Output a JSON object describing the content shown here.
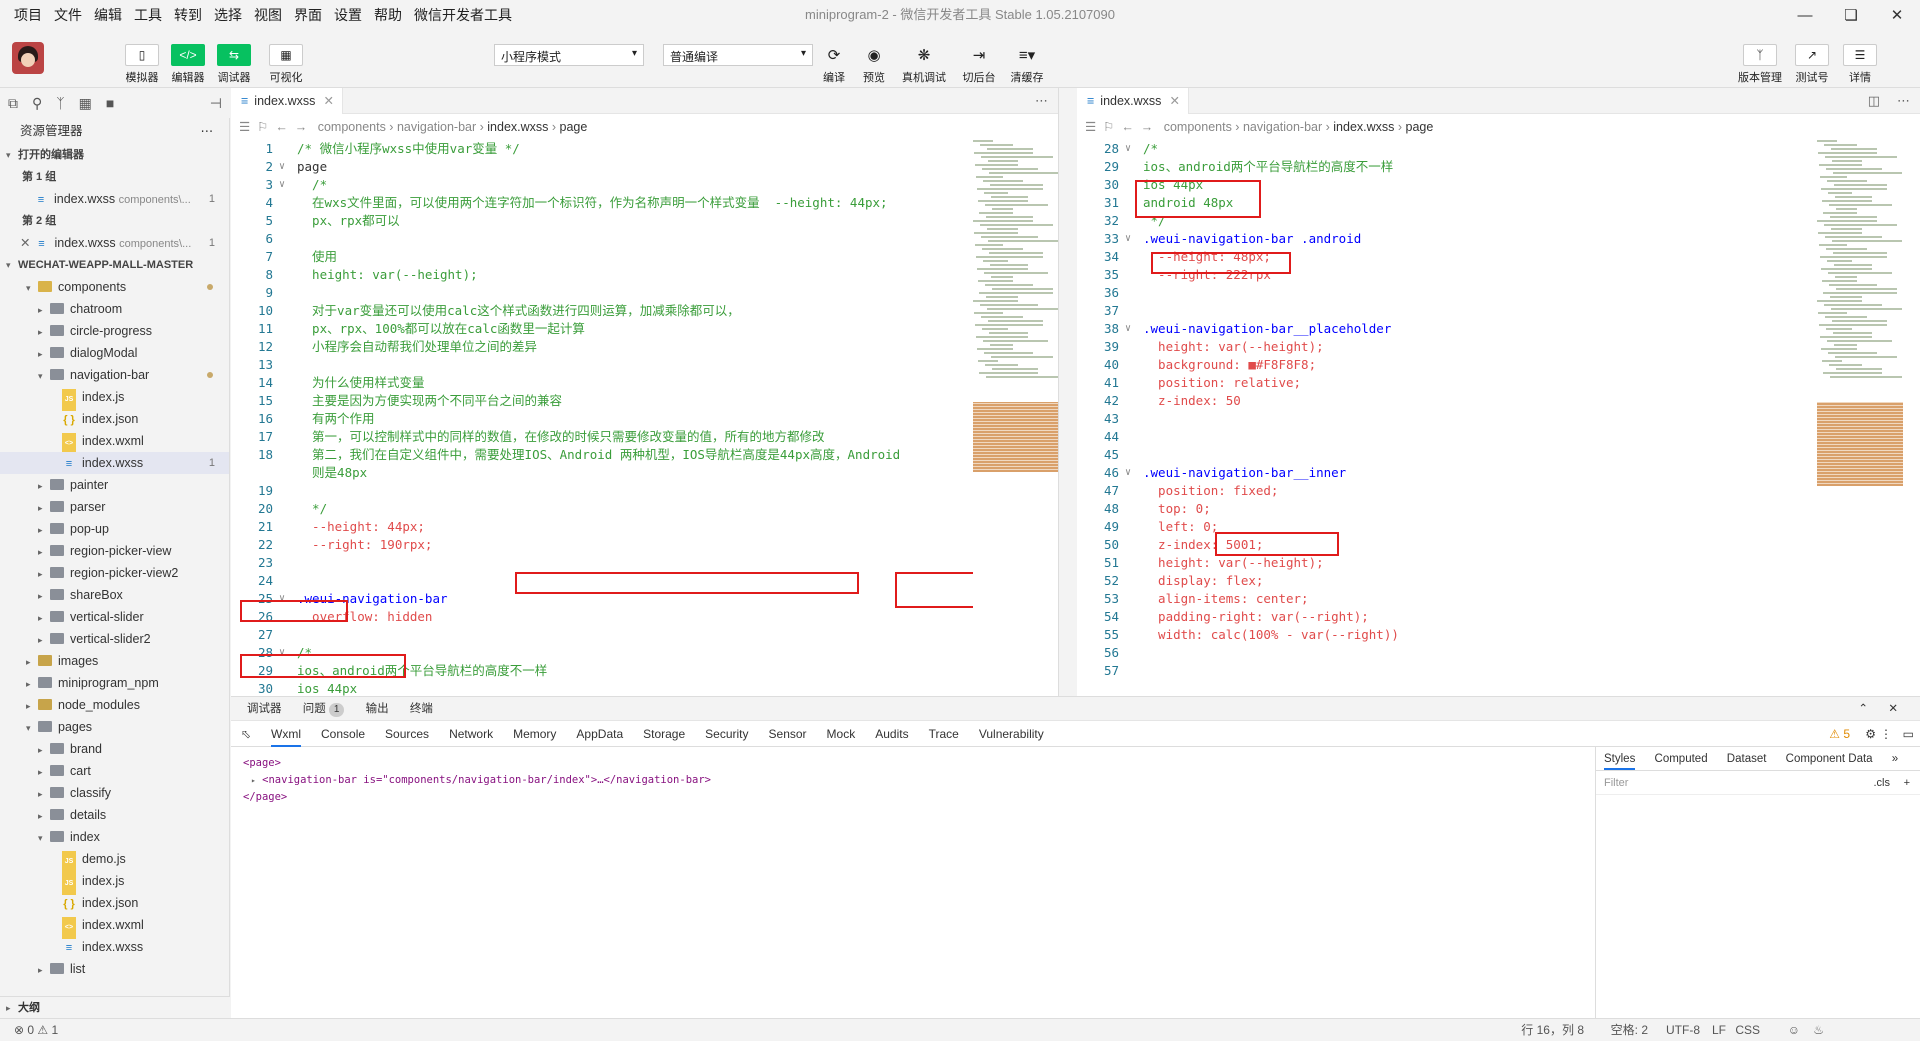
{
  "menu": [
    "项目",
    "文件",
    "编辑",
    "工具",
    "转到",
    "选择",
    "视图",
    "界面",
    "设置",
    "帮助",
    "微信开发者工具"
  ],
  "window_title": "miniprogram-2 - 微信开发者工具 Stable 1.05.2107090",
  "toolbar": {
    "simulator": "模拟器",
    "editor": "编辑器",
    "debugger": "调试器",
    "visual": "可视化",
    "mode_select": "小程序模式",
    "compile_select": "普通编译",
    "compile": "编译",
    "preview": "预览",
    "real_debug": "真机调试",
    "background": "切后台",
    "clear_cache": "清缓存",
    "version": "版本管理",
    "test": "测试号",
    "details": "详情"
  },
  "explorer": {
    "title": "资源管理器",
    "open_editors": "打开的编辑器",
    "group1": "第 1 组",
    "group2": "第 2 组",
    "open_file1": "index.wxss",
    "open_file1_path": "components\\...",
    "open_file2": "index.wxss",
    "open_file2_path": "components\\...",
    "badge": "1",
    "project": "WECHAT-WEAPP-MALL-MASTER",
    "outline": "大纲",
    "tree": [
      {
        "label": "components",
        "indent": 1,
        "kind": "folder-open-comp",
        "dot": true
      },
      {
        "label": "chatroom",
        "indent": 2,
        "kind": "folder"
      },
      {
        "label": "circle-progress",
        "indent": 2,
        "kind": "folder"
      },
      {
        "label": "dialogModal",
        "indent": 2,
        "kind": "folder"
      },
      {
        "label": "navigation-bar",
        "indent": 2,
        "kind": "folder-open",
        "dot": true
      },
      {
        "label": "index.js",
        "indent": 3,
        "kind": "js"
      },
      {
        "label": "index.json",
        "indent": 3,
        "kind": "json"
      },
      {
        "label": "index.wxml",
        "indent": 3,
        "kind": "wxml"
      },
      {
        "label": "index.wxss",
        "indent": 3,
        "kind": "wxss",
        "badge": "1",
        "selected": true
      },
      {
        "label": "painter",
        "indent": 2,
        "kind": "folder"
      },
      {
        "label": "parser",
        "indent": 2,
        "kind": "folder"
      },
      {
        "label": "pop-up",
        "indent": 2,
        "kind": "folder"
      },
      {
        "label": "region-picker-view",
        "indent": 2,
        "kind": "folder"
      },
      {
        "label": "region-picker-view2",
        "indent": 2,
        "kind": "folder"
      },
      {
        "label": "shareBox",
        "indent": 2,
        "kind": "folder"
      },
      {
        "label": "vertical-slider",
        "indent": 2,
        "kind": "folder"
      },
      {
        "label": "vertical-slider2",
        "indent": 2,
        "kind": "folder"
      },
      {
        "label": "images",
        "indent": 1,
        "kind": "folder-green"
      },
      {
        "label": "miniprogram_npm",
        "indent": 1,
        "kind": "folder"
      },
      {
        "label": "node_modules",
        "indent": 1,
        "kind": "folder-green"
      },
      {
        "label": "pages",
        "indent": 1,
        "kind": "folder-open"
      },
      {
        "label": "brand",
        "indent": 2,
        "kind": "folder"
      },
      {
        "label": "cart",
        "indent": 2,
        "kind": "folder"
      },
      {
        "label": "classify",
        "indent": 2,
        "kind": "folder"
      },
      {
        "label": "details",
        "indent": 2,
        "kind": "folder"
      },
      {
        "label": "index",
        "indent": 2,
        "kind": "folder-open"
      },
      {
        "label": "demo.js",
        "indent": 3,
        "kind": "js"
      },
      {
        "label": "index.js",
        "indent": 3,
        "kind": "js"
      },
      {
        "label": "index.json",
        "indent": 3,
        "kind": "json"
      },
      {
        "label": "index.wxml",
        "indent": 3,
        "kind": "wxml"
      },
      {
        "label": "index.wxss",
        "indent": 3,
        "kind": "wxss"
      },
      {
        "label": "list",
        "indent": 2,
        "kind": "folder"
      }
    ]
  },
  "editor_left": {
    "tab": "index.wxss",
    "breadcrumb": [
      "components",
      "navigation-bar",
      "index.wxss",
      "page"
    ],
    "lines": [
      {
        "n": "1",
        "t": "/* 微信小程序wxss中使用var变量 */",
        "c": "cm"
      },
      {
        "n": "2",
        "t": "page ",
        "c": "",
        "fold": true
      },
      {
        "n": "3",
        "t": "  /*",
        "c": "cm",
        "fold": true
      },
      {
        "n": "4",
        "t": "  在wxs文件里面，可以使用两个连字符加一个标识符，作为名称声明一个样式变量  --height: 44px;",
        "c": "cm"
      },
      {
        "n": "5",
        "t": "  px、rpx都可以",
        "c": "cm"
      },
      {
        "n": "6",
        "t": "",
        "c": ""
      },
      {
        "n": "7",
        "t": "  使用",
        "c": "cm"
      },
      {
        "n": "8",
        "t": "  height: var(--height);",
        "c": "cm"
      },
      {
        "n": "9",
        "t": "",
        "c": ""
      },
      {
        "n": "10",
        "t": "  对于var变量还可以使用calc这个样式函数进行四则运算，加减乘除都可以，",
        "c": "cm"
      },
      {
        "n": "11",
        "t": "  px、rpx、100%都可以放在calc函数里一起计算",
        "c": "cm"
      },
      {
        "n": "12",
        "t": "  小程序会自动帮我们处理单位之间的差异",
        "c": "cm"
      },
      {
        "n": "13",
        "t": "",
        "c": ""
      },
      {
        "n": "14",
        "t": "  为什么使用样式变量",
        "c": "cm"
      },
      {
        "n": "15",
        "t": "  主要是因为方便实现两个不同平台之间的兼容",
        "c": "cm"
      },
      {
        "n": "16",
        "t": "  有两个作用",
        "c": "cm"
      },
      {
        "n": "17",
        "t": "  第一，可以控制样式中的同样的数值，在修改的时候只需要修改变量的值，所有的地方都修改",
        "c": "cm"
      },
      {
        "n": "18",
        "t": "  第二，我们在自定义组件中，需要处理IOS、Android 两种机型，IOS导航栏高度是44px高度，Android",
        "c": "cm"
      },
      {
        "n": "",
        "t": "  则是48px",
        "c": "cm"
      },
      {
        "n": "19",
        "t": "",
        "c": ""
      },
      {
        "n": "20",
        "t": "  */",
        "c": "cm"
      },
      {
        "n": "21",
        "t": "  --height: 44px;",
        "c": "prop"
      },
      {
        "n": "22",
        "t": "  --right: 190rpx;",
        "c": "prop"
      },
      {
        "n": "23",
        "t": "",
        "c": ""
      },
      {
        "n": "24",
        "t": "",
        "c": ""
      },
      {
        "n": "25",
        "t": ".weui-navigation-bar ",
        "c": "kw",
        "fold": true
      },
      {
        "n": "26",
        "t": "  overflow: hidden",
        "c": "prop"
      },
      {
        "n": "27",
        "t": "",
        "c": ""
      },
      {
        "n": "28",
        "t": "/*",
        "c": "cm",
        "fold": true
      },
      {
        "n": "29",
        "t": "ios、android两个平台导航栏的高度不一样",
        "c": "cm"
      },
      {
        "n": "30",
        "t": "ios 44px",
        "c": "cm"
      }
    ]
  },
  "editor_right": {
    "tab": "index.wxss",
    "breadcrumb": [
      "components",
      "navigation-bar",
      "index.wxss",
      "page"
    ],
    "lines": [
      {
        "n": "28",
        "t": "/*",
        "c": "cm",
        "fold": true
      },
      {
        "n": "29",
        "t": "ios、android两个平台导航栏的高度不一样",
        "c": "cm"
      },
      {
        "n": "30",
        "t": "ios 44px",
        "c": "cm"
      },
      {
        "n": "31",
        "t": "android 48px",
        "c": "cm"
      },
      {
        "n": "32",
        "t": " */",
        "c": "cm"
      },
      {
        "n": "33",
        "t": ".weui-navigation-bar .android ",
        "c": "kw",
        "fold": true
      },
      {
        "n": "34",
        "t": "  --height: 48px;",
        "c": "prop"
      },
      {
        "n": "35",
        "t": "  --right: 222rpx",
        "c": "prop"
      },
      {
        "n": "36",
        "t": "",
        "c": ""
      },
      {
        "n": "37",
        "t": "",
        "c": ""
      },
      {
        "n": "38",
        "t": ".weui-navigation-bar__placeholder ",
        "c": "kw",
        "fold": true
      },
      {
        "n": "39",
        "t": "  height: var(--height);",
        "c": "prop"
      },
      {
        "n": "40",
        "t": "  background: ■#F8F8F8;",
        "c": "prop"
      },
      {
        "n": "41",
        "t": "  position: relative;",
        "c": "prop"
      },
      {
        "n": "42",
        "t": "  z-index: 50",
        "c": "prop"
      },
      {
        "n": "43",
        "t": "",
        "c": ""
      },
      {
        "n": "44",
        "t": "",
        "c": ""
      },
      {
        "n": "45",
        "t": "",
        "c": ""
      },
      {
        "n": "46",
        "t": ".weui-navigation-bar__inner ",
        "c": "kw",
        "fold": true
      },
      {
        "n": "47",
        "t": "  position: fixed;",
        "c": "prop"
      },
      {
        "n": "48",
        "t": "  top: 0;",
        "c": "prop"
      },
      {
        "n": "49",
        "t": "  left: 0;",
        "c": "prop"
      },
      {
        "n": "50",
        "t": "  z-index: 5001;",
        "c": "prop"
      },
      {
        "n": "51",
        "t": "  height: var(--height);",
        "c": "prop"
      },
      {
        "n": "52",
        "t": "  display: flex;",
        "c": "prop"
      },
      {
        "n": "53",
        "t": "  align-items: center;",
        "c": "prop"
      },
      {
        "n": "54",
        "t": "  padding-right: var(--right);",
        "c": "prop"
      },
      {
        "n": "55",
        "t": "  width: calc(100% - var(--right))",
        "c": "prop"
      },
      {
        "n": "56",
        "t": "",
        "c": ""
      },
      {
        "n": "57",
        "t": "",
        "c": ""
      }
    ]
  },
  "devtools": {
    "head": [
      "调试器",
      "问题",
      "输出",
      "终端"
    ],
    "problems": "1",
    "tabs": [
      "Wxml",
      "Console",
      "Sources",
      "Network",
      "Memory",
      "AppData",
      "Storage",
      "Security",
      "Sensor",
      "Mock",
      "Audits",
      "Trace",
      "Vulnerability"
    ],
    "warnings": "5",
    "dom": [
      "<page>",
      "<navigation-bar is=\"components/navigation-bar/index\">…</navigation-bar>",
      "</page>"
    ],
    "style_tabs": [
      "Styles",
      "Computed",
      "Dataset",
      "Component Data"
    ],
    "filter_placeholder": "Filter",
    "cls": ".cls"
  },
  "status": {
    "left": "⊗ 0 ⚠ 1",
    "position": "行 16，列 8",
    "spaces": "空格: 2",
    "encoding": "UTF-8",
    "eol": "LF",
    "lang": "CSS"
  }
}
